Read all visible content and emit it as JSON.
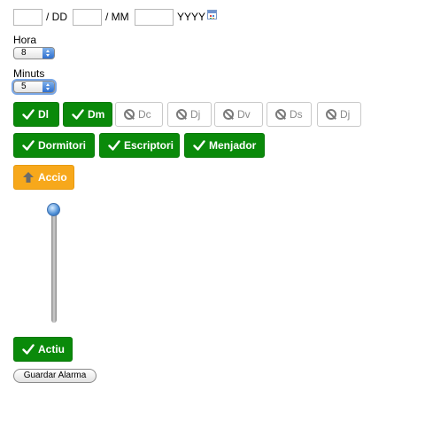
{
  "date": {
    "dd_value": "",
    "mm_value": "",
    "yyyy_value": "",
    "sep1": "/ DD",
    "sep2": "/ MM",
    "sep3": "YYYY",
    "calendar_icon": "calendar-icon"
  },
  "hora": {
    "label": "Hora",
    "value": "8"
  },
  "minuts": {
    "label": "Minuts",
    "value": "5"
  },
  "days": [
    {
      "label": "Dl",
      "active": true
    },
    {
      "label": "Dm",
      "active": true
    },
    {
      "label": "Dc",
      "active": false
    },
    {
      "label": "Dj",
      "active": false
    },
    {
      "label": "Dv",
      "active": false
    },
    {
      "label": "Ds",
      "active": false
    },
    {
      "label": "Dj",
      "active": false
    }
  ],
  "rooms": [
    {
      "label": "Dormitori",
      "active": true
    },
    {
      "label": "Escriptori",
      "active": true
    },
    {
      "label": "Menjador",
      "active": true
    }
  ],
  "accio": {
    "label": "Accio",
    "icon": "arrow-up-icon"
  },
  "slider": {
    "value": 1.0
  },
  "actiu": {
    "label": "Actiu",
    "active": true
  },
  "save": {
    "label": "Guardar Alarma"
  },
  "colors": {
    "green": "#0a8a0a",
    "orange": "#f7a81b",
    "inactive_border": "#c9c9c9"
  }
}
